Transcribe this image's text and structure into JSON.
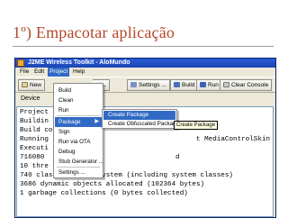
{
  "slide": {
    "title": "1º) Empacotar aplicação"
  },
  "window": {
    "title": "J2ME Wireless Toolkit - AloMundo"
  },
  "menubar": {
    "items": [
      "File",
      "Edit",
      "Project",
      "Help"
    ],
    "active": "Project"
  },
  "toolbar": {
    "new_label": "New",
    "project_label": "ct ...",
    "settings_label": "Settings ...",
    "build_label": "Build",
    "run_label": "Run",
    "clear_console_label": "Clear Console"
  },
  "device_bar": {
    "label": "Device"
  },
  "project_menu": {
    "items": [
      "Build",
      "Clean",
      "Run",
      "Package",
      "Sign",
      "Run via OTA",
      "Debug",
      "Stub Generator ...",
      "Settings ..."
    ],
    "highlighted": "Package"
  },
  "package_submenu": {
    "items": [
      "Create Package",
      "Create Obfuscated Package"
    ],
    "highlighted": "Create Package"
  },
  "tooltip": {
    "text": "Create Package"
  },
  "console": {
    "lines": [
      "Project",
      "Buildin",
      "Build co",
      "Running",
      "Executi",
      "716080",
      "10 thre",
      "740 classes in the system (including system classes)",
      "3686 dynamic objects allocated (102364 bytes)",
      "1 garbage collections (0 bytes collected)"
    ],
    "fragments": {
      "running_suffix": "t MediaControlSkin",
      "line6_suffix": "d"
    }
  },
  "colors": {
    "title_accent": "#b3472a",
    "titlebar": "#1c46b5",
    "highlight": "#316ac5",
    "tooltip_bg": "#ffffe1"
  }
}
